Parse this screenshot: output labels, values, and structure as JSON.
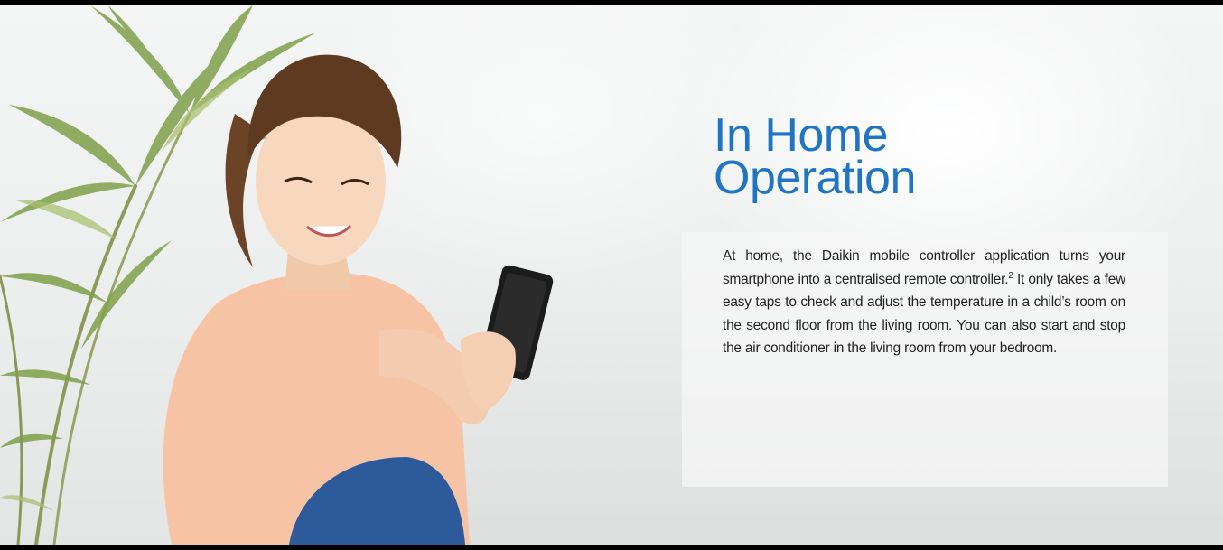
{
  "headline": {
    "line1": "In Home",
    "line2": "Operation"
  },
  "body": {
    "before_footnote": "At home, the Daikin mobile controller application turns your smartphone into a centralised remote controller.",
    "footnote_marker": "2",
    "after_footnote": " It only takes a few easy taps to check and adjust the temperature in a child’s room on the second floor from the living room. You can also start and stop the air conditioner in the living room from your bedroom."
  },
  "colors": {
    "headline": "#1f74c4",
    "body_text": "#222222"
  }
}
